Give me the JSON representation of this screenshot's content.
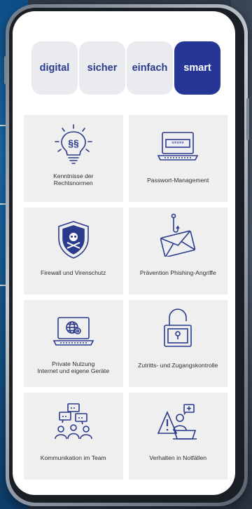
{
  "tabs": [
    {
      "label": "digital"
    },
    {
      "label": "sicher"
    },
    {
      "label": "einfach"
    },
    {
      "label": "smart"
    }
  ],
  "colors": {
    "accent": "#253696",
    "tab_text": "#2a3a8c",
    "icon_stroke": "#2a3a8c",
    "card_bg": "#efefef",
    "tab_bg": "#e9ebee"
  },
  "cards": [
    {
      "icon": "law-lightbulb-icon",
      "line1": "Kenntnisse der",
      "line2": "Rechtsnormen"
    },
    {
      "icon": "password-laptop-icon",
      "line1": "Passwort-Management"
    },
    {
      "icon": "virus-shield-icon",
      "line1": "Firewall und Virenschutz"
    },
    {
      "icon": "phishing-envelope-icon",
      "line1": "Prävention  Phishing-Angriffe"
    },
    {
      "icon": "globe-laptop-icon",
      "line1": "Private  Nutzung",
      "line2": "Internet und eigene Geräte"
    },
    {
      "icon": "padlock-icon",
      "line1": "Zutritts- und Zugangskontrolle"
    },
    {
      "icon": "team-chat-icon",
      "line1": "Kommunikation im Team"
    },
    {
      "icon": "warning-person-icon",
      "line1": "Verhalten in  Notfällen"
    }
  ]
}
